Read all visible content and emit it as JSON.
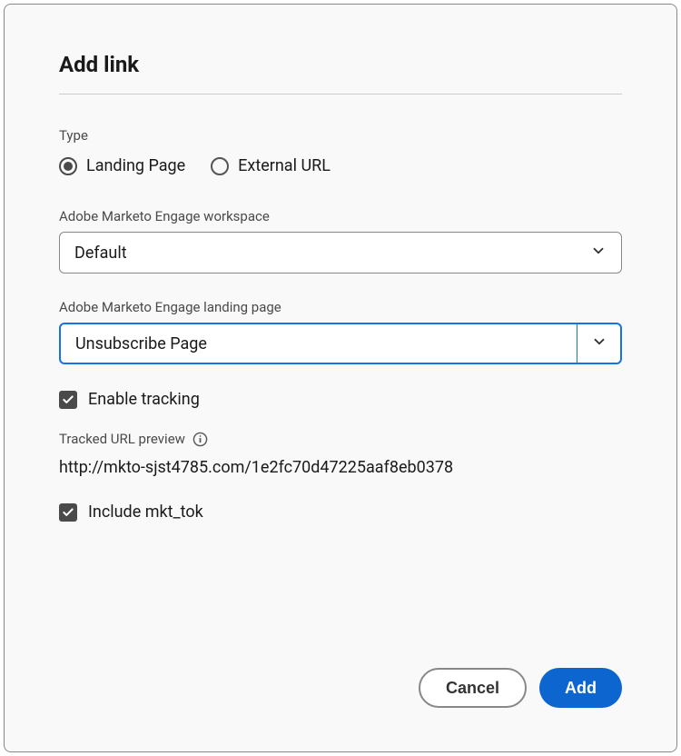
{
  "title": "Add link",
  "type": {
    "label": "Type",
    "options": {
      "landing_page": "Landing Page",
      "external_url": "External URL"
    },
    "selected": "landing_page"
  },
  "workspace": {
    "label": "Adobe Marketo Engage workspace",
    "value": "Default"
  },
  "landing_page": {
    "label": "Adobe Marketo Engage landing page",
    "value": "Unsubscribe Page"
  },
  "enable_tracking": {
    "label": "Enable tracking",
    "checked": true
  },
  "tracked_preview": {
    "label": "Tracked URL preview",
    "url": "http://mkto-sjst4785.com/1e2fc70d47225aaf8eb0378"
  },
  "include_mkt_tok": {
    "label": "Include mkt_tok",
    "checked": true
  },
  "buttons": {
    "cancel": "Cancel",
    "add": "Add"
  }
}
